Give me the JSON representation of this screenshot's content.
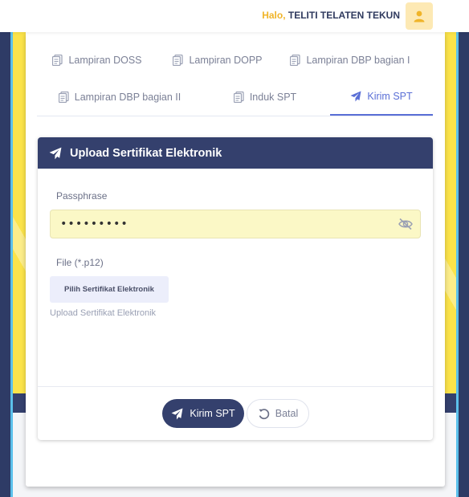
{
  "header": {
    "greeting_prefix": "Halo,",
    "user_name": "TELITI TELATEN TEKUN",
    "avatar_icon": "user-icon"
  },
  "tabs": [
    {
      "label": "Lampiran DOSS",
      "icon": "document-icon"
    },
    {
      "label": "Lampiran DOPP",
      "icon": "document-icon"
    },
    {
      "label": "Lampiran DBP bagian I",
      "icon": "document-icon"
    },
    {
      "label": "Lampiran DBP bagian II",
      "icon": "document-icon"
    },
    {
      "label": "Induk SPT",
      "icon": "document-icon"
    },
    {
      "label": "Kirim SPT",
      "icon": "send-icon",
      "active": true
    }
  ],
  "panel": {
    "title": "Upload Sertifikat Elektronik",
    "passphrase_label": "Passphrase",
    "passphrase_value": "•••••••••",
    "file_label": "File (*.p12)",
    "file_button": "Pilih Sertifikat Elektronik",
    "file_helper": "Upload Sertifikat Elektronik",
    "submit_label": "Kirim SPT",
    "cancel_label": "Batal"
  },
  "colors": {
    "navy": "#34406d",
    "accent": "#5a6fd6",
    "highlight_yellow": "#fbe34a",
    "greeting": "#f0b429"
  }
}
